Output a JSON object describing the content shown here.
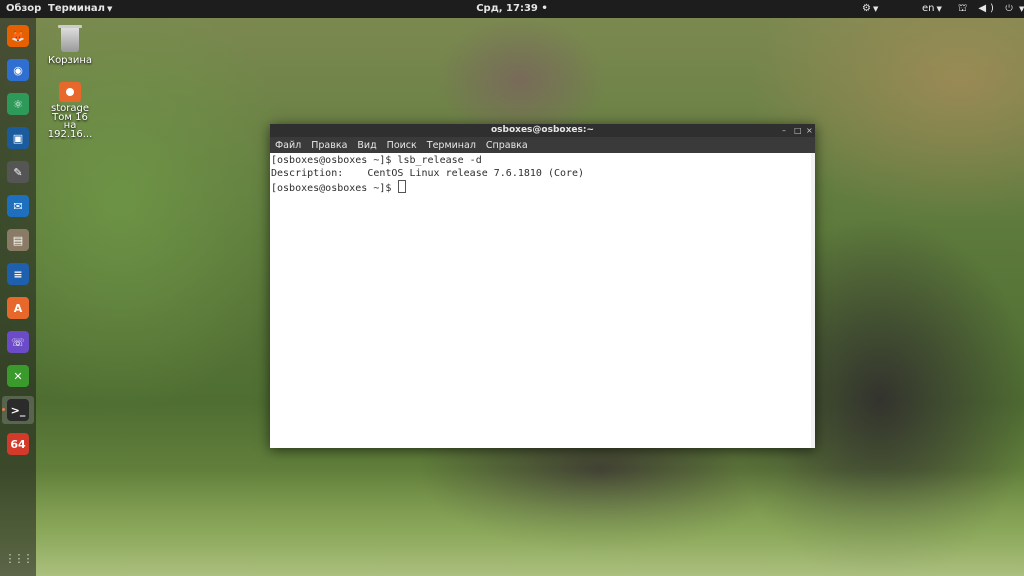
{
  "topbar": {
    "overview": "Обзор",
    "app_menu": "Терминал",
    "clock": "Срд, 17:39",
    "clock_dot": "•",
    "accessibility": "⚙",
    "language": "en",
    "system_icons": "⛫ ◀) ⏻"
  },
  "dock": {
    "items": [
      {
        "name": "firefox",
        "glyph": "🦊",
        "color": "#e66000"
      },
      {
        "name": "chromium",
        "glyph": "◉",
        "color": "#2f6fd1"
      },
      {
        "name": "atom",
        "glyph": "⚛",
        "color": "#2e9a5a"
      },
      {
        "name": "virtualbox",
        "glyph": "▣",
        "color": "#1b5c9e"
      },
      {
        "name": "gimp",
        "glyph": "✎",
        "color": "#555"
      },
      {
        "name": "thunderbird",
        "glyph": "✉",
        "color": "#1f6fbf"
      },
      {
        "name": "files",
        "glyph": "▤",
        "color": "#8a7b66"
      },
      {
        "name": "writer",
        "glyph": "≡",
        "color": "#1e5fae"
      },
      {
        "name": "software",
        "glyph": "A",
        "color": "#e8672a"
      },
      {
        "name": "viber",
        "glyph": "☏",
        "color": "#6b4bc7"
      },
      {
        "name": "crossover",
        "glyph": "✕",
        "color": "#3a9a2b"
      },
      {
        "name": "terminal",
        "glyph": ">_",
        "color": "#2b2b2b"
      },
      {
        "name": "app-64",
        "glyph": "64",
        "color": "#d43a2a"
      }
    ],
    "apps_grid": "⋮⋮⋮"
  },
  "desktop": {
    "trash_label": "Корзина",
    "drive_label_1": "storage",
    "drive_label_2": "Том 16",
    "drive_label_3": "на",
    "drive_label_4": "192.16..."
  },
  "window": {
    "title": "osboxes@osboxes:~",
    "controls": {
      "minimize": "–",
      "maximize": "□",
      "close": "×"
    },
    "menu": [
      "Файл",
      "Правка",
      "Вид",
      "Поиск",
      "Терминал",
      "Справка"
    ],
    "terminal_lines": [
      "[osboxes@osboxes ~]$ lsb_release -d",
      "Description:    CentOS Linux release 7.6.1810 (Core)",
      "[osboxes@osboxes ~]$ "
    ]
  }
}
